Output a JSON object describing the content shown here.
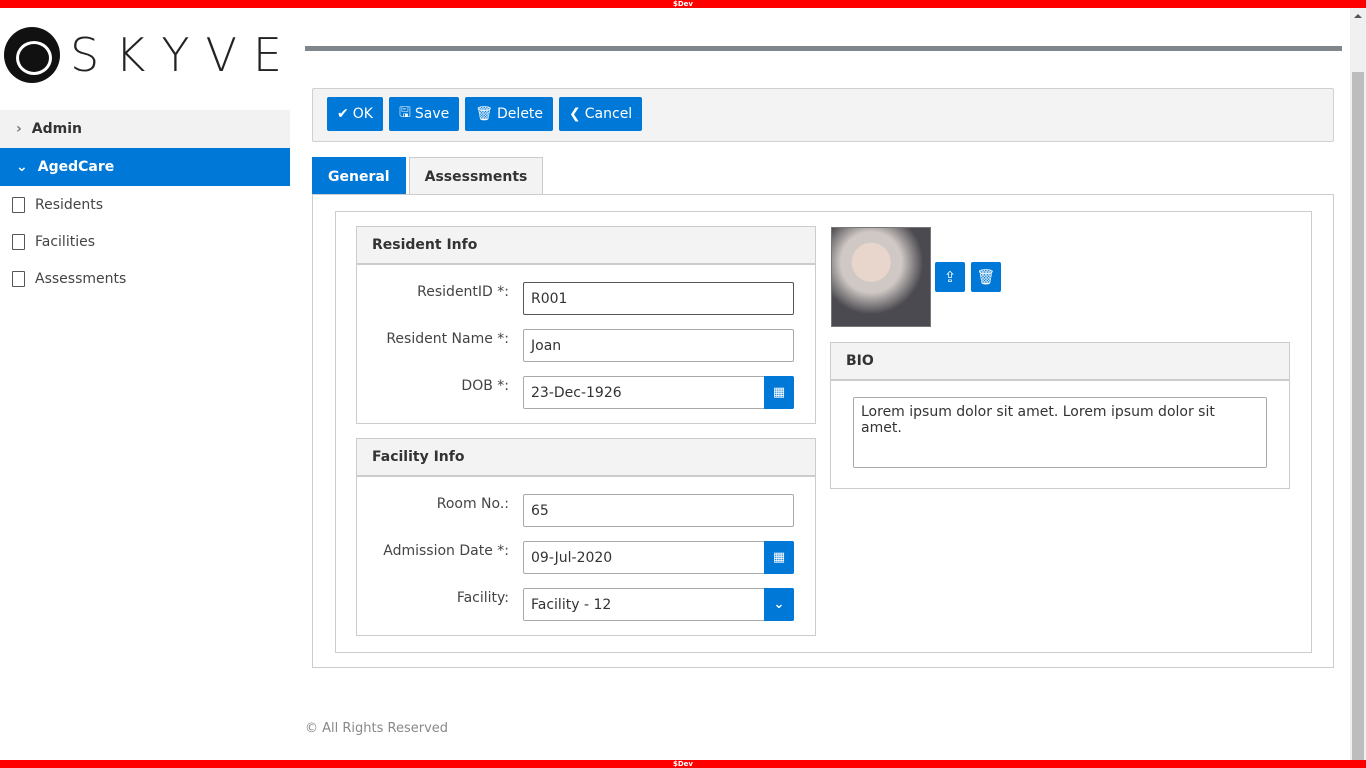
{
  "env_banner": "$Dev",
  "logo_text": "SKYVE",
  "nav": {
    "groups": [
      {
        "label": "Admin",
        "expanded": false
      },
      {
        "label": "AgedCare",
        "expanded": true
      }
    ],
    "items": [
      {
        "label": "Residents"
      },
      {
        "label": "Facilities"
      },
      {
        "label": "Assessments"
      }
    ]
  },
  "toolbar": {
    "ok": "OK",
    "save": "Save",
    "delete": "Delete",
    "cancel": "Cancel"
  },
  "tabs": [
    {
      "label": "General",
      "active": true
    },
    {
      "label": "Assessments",
      "active": false
    }
  ],
  "resident_info": {
    "title": "Resident Info",
    "fields": [
      {
        "label": "ResidentID *:",
        "value": "R001"
      },
      {
        "label": "Resident Name *:",
        "value": "Joan"
      },
      {
        "label": "DOB *:",
        "value": "23-Dec-1926"
      }
    ]
  },
  "facility_info": {
    "title": "Facility Info",
    "fields": [
      {
        "label": "Room No.:",
        "value": "65"
      },
      {
        "label": "Admission Date *:",
        "value": "09-Jul-2020"
      },
      {
        "label": "Facility:",
        "value": "Facility - 12"
      }
    ]
  },
  "bio": {
    "title": "BIO",
    "value": "Lorem ipsum dolor sit amet. Lorem ipsum dolor sit amet."
  },
  "footer": "© All Rights Reserved",
  "colors": {
    "primary": "#0078d7",
    "dev_banner": "#ff0000"
  }
}
